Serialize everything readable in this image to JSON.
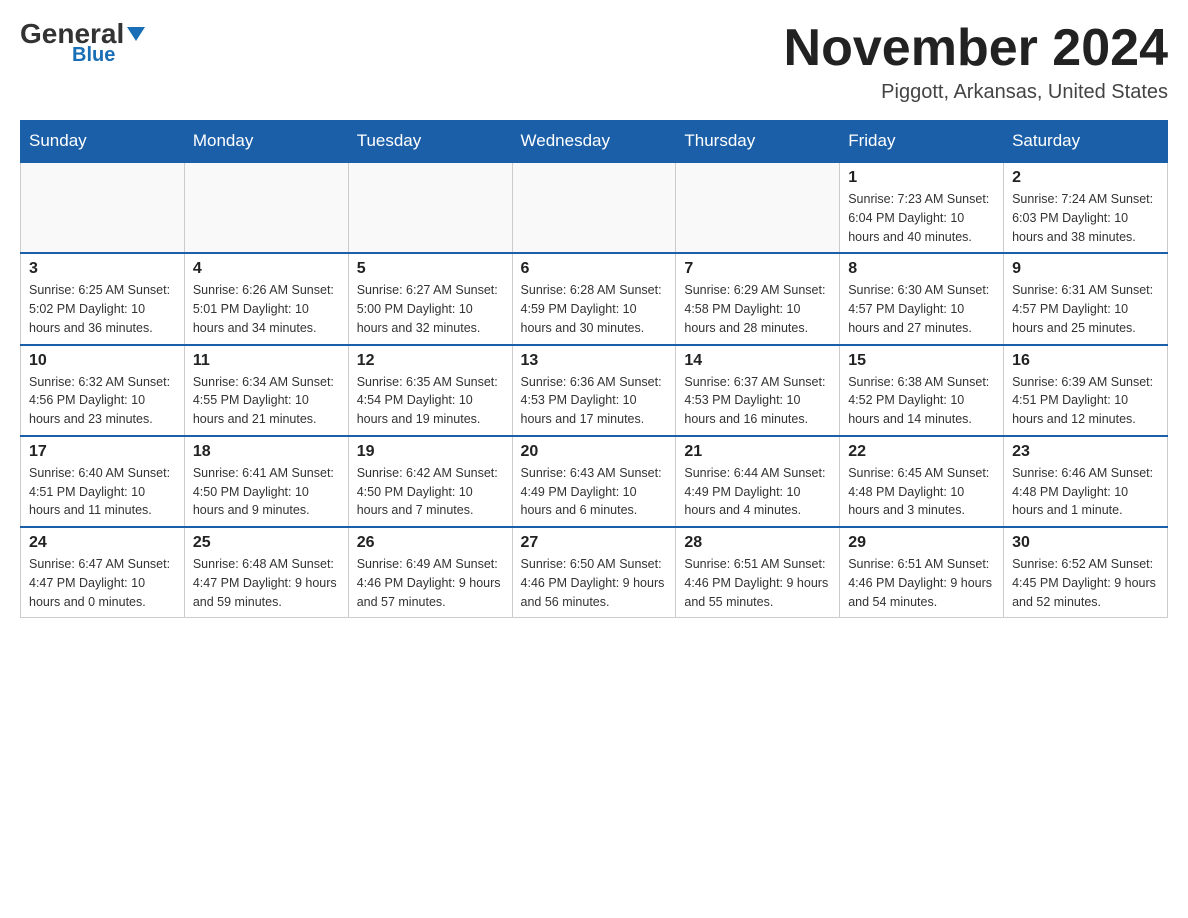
{
  "logo": {
    "general": "General",
    "blue": "Blue"
  },
  "title": {
    "month_year": "November 2024",
    "location": "Piggott, Arkansas, United States"
  },
  "days_of_week": [
    "Sunday",
    "Monday",
    "Tuesday",
    "Wednesday",
    "Thursday",
    "Friday",
    "Saturday"
  ],
  "weeks": [
    [
      {
        "day": "",
        "info": ""
      },
      {
        "day": "",
        "info": ""
      },
      {
        "day": "",
        "info": ""
      },
      {
        "day": "",
        "info": ""
      },
      {
        "day": "",
        "info": ""
      },
      {
        "day": "1",
        "info": "Sunrise: 7:23 AM\nSunset: 6:04 PM\nDaylight: 10 hours and 40 minutes."
      },
      {
        "day": "2",
        "info": "Sunrise: 7:24 AM\nSunset: 6:03 PM\nDaylight: 10 hours and 38 minutes."
      }
    ],
    [
      {
        "day": "3",
        "info": "Sunrise: 6:25 AM\nSunset: 5:02 PM\nDaylight: 10 hours and 36 minutes."
      },
      {
        "day": "4",
        "info": "Sunrise: 6:26 AM\nSunset: 5:01 PM\nDaylight: 10 hours and 34 minutes."
      },
      {
        "day": "5",
        "info": "Sunrise: 6:27 AM\nSunset: 5:00 PM\nDaylight: 10 hours and 32 minutes."
      },
      {
        "day": "6",
        "info": "Sunrise: 6:28 AM\nSunset: 4:59 PM\nDaylight: 10 hours and 30 minutes."
      },
      {
        "day": "7",
        "info": "Sunrise: 6:29 AM\nSunset: 4:58 PM\nDaylight: 10 hours and 28 minutes."
      },
      {
        "day": "8",
        "info": "Sunrise: 6:30 AM\nSunset: 4:57 PM\nDaylight: 10 hours and 27 minutes."
      },
      {
        "day": "9",
        "info": "Sunrise: 6:31 AM\nSunset: 4:57 PM\nDaylight: 10 hours and 25 minutes."
      }
    ],
    [
      {
        "day": "10",
        "info": "Sunrise: 6:32 AM\nSunset: 4:56 PM\nDaylight: 10 hours and 23 minutes."
      },
      {
        "day": "11",
        "info": "Sunrise: 6:34 AM\nSunset: 4:55 PM\nDaylight: 10 hours and 21 minutes."
      },
      {
        "day": "12",
        "info": "Sunrise: 6:35 AM\nSunset: 4:54 PM\nDaylight: 10 hours and 19 minutes."
      },
      {
        "day": "13",
        "info": "Sunrise: 6:36 AM\nSunset: 4:53 PM\nDaylight: 10 hours and 17 minutes."
      },
      {
        "day": "14",
        "info": "Sunrise: 6:37 AM\nSunset: 4:53 PM\nDaylight: 10 hours and 16 minutes."
      },
      {
        "day": "15",
        "info": "Sunrise: 6:38 AM\nSunset: 4:52 PM\nDaylight: 10 hours and 14 minutes."
      },
      {
        "day": "16",
        "info": "Sunrise: 6:39 AM\nSunset: 4:51 PM\nDaylight: 10 hours and 12 minutes."
      }
    ],
    [
      {
        "day": "17",
        "info": "Sunrise: 6:40 AM\nSunset: 4:51 PM\nDaylight: 10 hours and 11 minutes."
      },
      {
        "day": "18",
        "info": "Sunrise: 6:41 AM\nSunset: 4:50 PM\nDaylight: 10 hours and 9 minutes."
      },
      {
        "day": "19",
        "info": "Sunrise: 6:42 AM\nSunset: 4:50 PM\nDaylight: 10 hours and 7 minutes."
      },
      {
        "day": "20",
        "info": "Sunrise: 6:43 AM\nSunset: 4:49 PM\nDaylight: 10 hours and 6 minutes."
      },
      {
        "day": "21",
        "info": "Sunrise: 6:44 AM\nSunset: 4:49 PM\nDaylight: 10 hours and 4 minutes."
      },
      {
        "day": "22",
        "info": "Sunrise: 6:45 AM\nSunset: 4:48 PM\nDaylight: 10 hours and 3 minutes."
      },
      {
        "day": "23",
        "info": "Sunrise: 6:46 AM\nSunset: 4:48 PM\nDaylight: 10 hours and 1 minute."
      }
    ],
    [
      {
        "day": "24",
        "info": "Sunrise: 6:47 AM\nSunset: 4:47 PM\nDaylight: 10 hours and 0 minutes."
      },
      {
        "day": "25",
        "info": "Sunrise: 6:48 AM\nSunset: 4:47 PM\nDaylight: 9 hours and 59 minutes."
      },
      {
        "day": "26",
        "info": "Sunrise: 6:49 AM\nSunset: 4:46 PM\nDaylight: 9 hours and 57 minutes."
      },
      {
        "day": "27",
        "info": "Sunrise: 6:50 AM\nSunset: 4:46 PM\nDaylight: 9 hours and 56 minutes."
      },
      {
        "day": "28",
        "info": "Sunrise: 6:51 AM\nSunset: 4:46 PM\nDaylight: 9 hours and 55 minutes."
      },
      {
        "day": "29",
        "info": "Sunrise: 6:51 AM\nSunset: 4:46 PM\nDaylight: 9 hours and 54 minutes."
      },
      {
        "day": "30",
        "info": "Sunrise: 6:52 AM\nSunset: 4:45 PM\nDaylight: 9 hours and 52 minutes."
      }
    ]
  ]
}
